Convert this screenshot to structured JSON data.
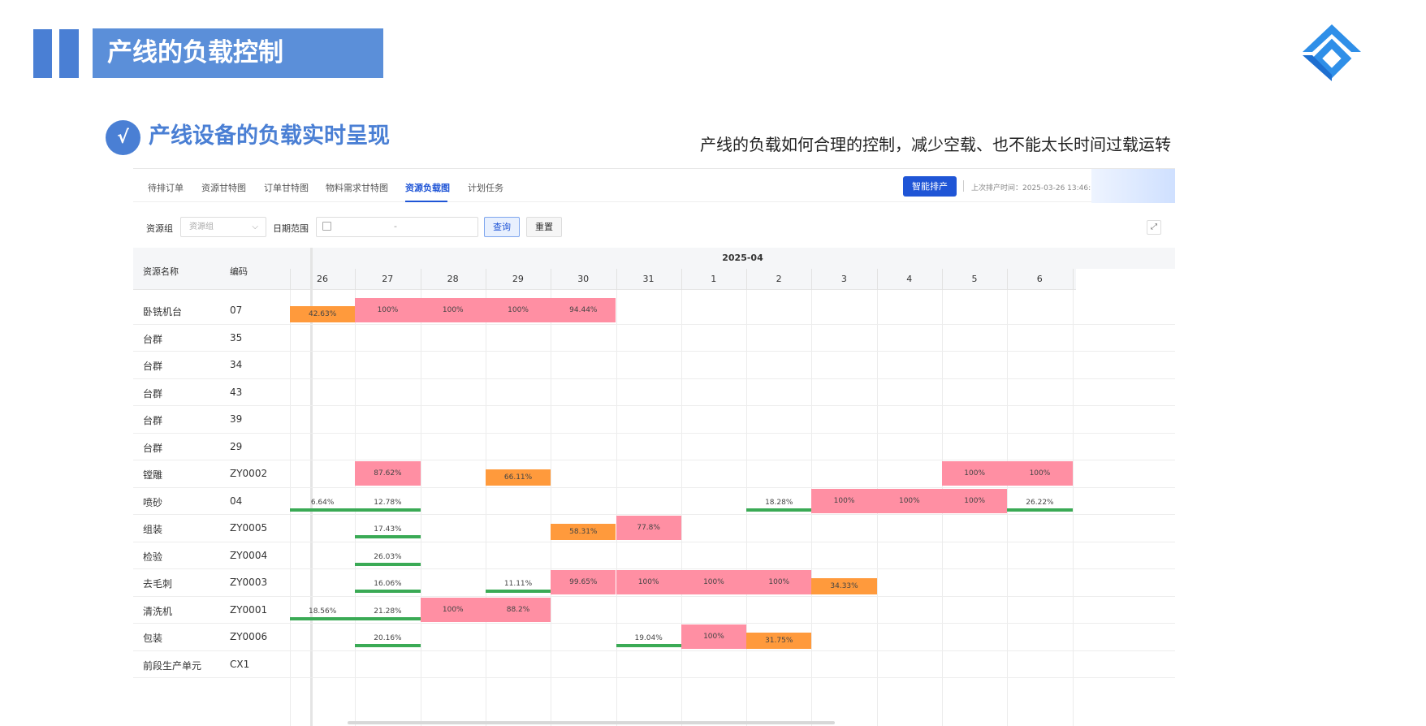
{
  "slide": {
    "title": "产线的负载控制",
    "check_glyph": "√",
    "subtitle": "产线设备的负载实时呈现",
    "description": "产线的负载如何合理的控制，减少空载、也不能太长时间过载运转"
  },
  "app": {
    "tabs": [
      "待排订单",
      "资源甘特图",
      "订单甘特图",
      "物料需求甘特图",
      "资源负载图",
      "计划任务"
    ],
    "active_tab": "资源负载图",
    "primary_button": "智能排产",
    "last_schedule_time": "上次排产时间：2025-03-26 13:46:11"
  },
  "filters": {
    "resource_group_label": "资源组",
    "resource_group_placeholder": "资源组",
    "date_range_label": "日期范围",
    "date_separator": "-",
    "query_button": "查询",
    "reset_button": "重置"
  },
  "table": {
    "col_name_header": "资源名称",
    "col_code_header": "编码",
    "month": "2025-04",
    "days": [
      "26",
      "27",
      "28",
      "29",
      "30",
      "31",
      "1",
      "2",
      "3",
      "4",
      "5",
      "6"
    ],
    "rows": [
      {
        "name": "卧铣机台",
        "code": "07",
        "loads": [
          {
            "day": 0,
            "value": "42.63%",
            "level": "mid"
          },
          {
            "day": 1,
            "value": "100%",
            "level": "full"
          },
          {
            "day": 2,
            "value": "100%",
            "level": "full"
          },
          {
            "day": 3,
            "value": "100%",
            "level": "full"
          },
          {
            "day": 4,
            "value": "94.44%",
            "level": "full"
          }
        ]
      },
      {
        "name": "台群",
        "code": "35",
        "loads": []
      },
      {
        "name": "台群",
        "code": "34",
        "loads": []
      },
      {
        "name": "台群",
        "code": "43",
        "loads": []
      },
      {
        "name": "台群",
        "code": "39",
        "loads": []
      },
      {
        "name": "台群",
        "code": "29",
        "loads": []
      },
      {
        "name": "镗雕",
        "code": "ZY0002",
        "loads": [
          {
            "day": 1,
            "value": "87.62%",
            "level": "full"
          },
          {
            "day": 3,
            "value": "66.11%",
            "level": "mid"
          },
          {
            "day": 10,
            "value": "100%",
            "level": "full"
          },
          {
            "day": 11,
            "value": "100%",
            "level": "full"
          }
        ]
      },
      {
        "name": "喷砂",
        "code": "04",
        "loads": [
          {
            "day": 0,
            "value": "6.64%",
            "level": "low"
          },
          {
            "day": 1,
            "value": "12.78%",
            "level": "low"
          },
          {
            "day": 7,
            "value": "18.28%",
            "level": "low"
          },
          {
            "day": 8,
            "value": "100%",
            "level": "full"
          },
          {
            "day": 9,
            "value": "100%",
            "level": "full"
          },
          {
            "day": 10,
            "value": "100%",
            "level": "full"
          },
          {
            "day": 11,
            "value": "26.22%",
            "level": "low"
          }
        ]
      },
      {
        "name": "组装",
        "code": "ZY0005",
        "loads": [
          {
            "day": 1,
            "value": "17.43%",
            "level": "low"
          },
          {
            "day": 4,
            "value": "58.31%",
            "level": "mid"
          },
          {
            "day": 5,
            "value": "77.8%",
            "level": "full"
          }
        ]
      },
      {
        "name": "检验",
        "code": "ZY0004",
        "loads": [
          {
            "day": 1,
            "value": "26.03%",
            "level": "low"
          }
        ]
      },
      {
        "name": "去毛刺",
        "code": "ZY0003",
        "loads": [
          {
            "day": 1,
            "value": "16.06%",
            "level": "low"
          },
          {
            "day": 3,
            "value": "11.11%",
            "level": "low"
          },
          {
            "day": 4,
            "value": "99.65%",
            "level": "full"
          },
          {
            "day": 5,
            "value": "100%",
            "level": "full"
          },
          {
            "day": 6,
            "value": "100%",
            "level": "full"
          },
          {
            "day": 7,
            "value": "100%",
            "level": "full"
          },
          {
            "day": 8,
            "value": "34.33%",
            "level": "mid"
          }
        ]
      },
      {
        "name": "清洗机",
        "code": "ZY0001",
        "loads": [
          {
            "day": 0,
            "value": "18.56%",
            "level": "low"
          },
          {
            "day": 1,
            "value": "21.28%",
            "level": "low"
          },
          {
            "day": 2,
            "value": "100%",
            "level": "full"
          },
          {
            "day": 3,
            "value": "88.2%",
            "level": "full"
          }
        ]
      },
      {
        "name": "包装",
        "code": "ZY0006",
        "loads": [
          {
            "day": 1,
            "value": "20.16%",
            "level": "low"
          },
          {
            "day": 5,
            "value": "19.04%",
            "level": "low"
          },
          {
            "day": 6,
            "value": "100%",
            "level": "full"
          },
          {
            "day": 7,
            "value": "31.75%",
            "level": "mid"
          }
        ]
      },
      {
        "name": "前段生产单元",
        "code": "CX1",
        "loads": []
      }
    ]
  },
  "colors": {
    "accent": "#4a7fd4",
    "primary": "#1f55d6",
    "overload": "#ff8fa3",
    "medium": "#ff9a3c",
    "light": "#3aaa55"
  }
}
